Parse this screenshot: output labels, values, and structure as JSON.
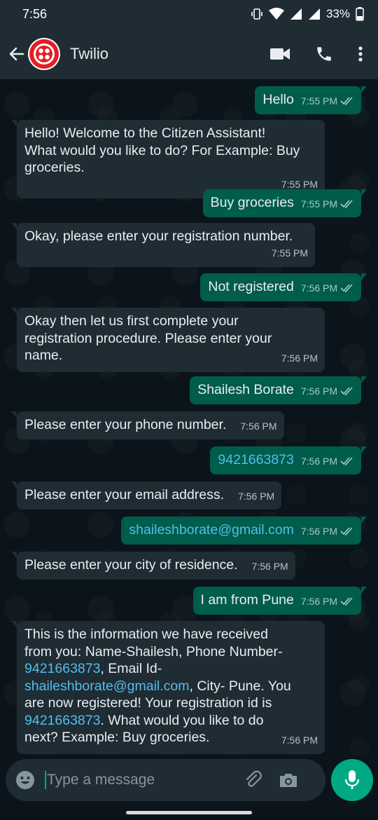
{
  "status": {
    "time": "7:56",
    "battery": "33%"
  },
  "header": {
    "title": "Twilio"
  },
  "messages": [
    {
      "dir": "out",
      "text": "Hello",
      "time": "7:55 PM"
    },
    {
      "dir": "in",
      "lines": [
        "Hello! Welcome to the Citizen Assistant!",
        "What would you like to do? For Example: Buy",
        "groceries."
      ],
      "time": "7:55 PM"
    },
    {
      "dir": "out",
      "text": "Buy groceries",
      "time": "7:55 PM"
    },
    {
      "dir": "in",
      "lines": [
        "Okay, please enter your registration number."
      ],
      "time": "7:55 PM"
    },
    {
      "dir": "out",
      "text": "Not registered",
      "time": "7:56 PM"
    },
    {
      "dir": "in",
      "lines": [
        "Okay then let us first complete your",
        "registration procedure. Please enter your",
        "name."
      ],
      "time": "7:56 PM"
    },
    {
      "dir": "out",
      "text": "Shailesh Borate",
      "time": "7:56 PM"
    },
    {
      "dir": "in",
      "text": "Please enter your phone number.",
      "time": "7:56 PM"
    },
    {
      "dir": "out",
      "text": "9421663873",
      "time": "7:56 PM"
    },
    {
      "dir": "in",
      "text": "Please enter your email address.",
      "time": "7:56 PM"
    },
    {
      "dir": "out",
      "text": "shaileshborate@gmail.com",
      "time": "7:56 PM"
    },
    {
      "dir": "in",
      "text": "Please enter your city of residence.",
      "time": "7:56 PM"
    },
    {
      "dir": "out",
      "text": "I am from Pune",
      "time": "7:56 PM"
    },
    {
      "dir": "in",
      "line1": "This is the information we have received",
      "line2": "from you: Name-Shailesh, Phone Number-",
      "phone": "9421663873",
      "line3b": ", Email Id-",
      "email": "shaileshborate@gmail.com",
      "line4b": ", City- Pune. You",
      "line5": "are now registered! Your registration id is",
      "line6b": ". What would you like to do",
      "line7": "next? Example: Buy groceries.",
      "time": "7:56 PM"
    }
  ],
  "composer": {
    "placeholder": "Type a message"
  },
  "icons": {
    "back": "arrow-left-icon",
    "avatar": "twilio-logo-icon",
    "video": "video-camera-icon",
    "call": "phone-icon",
    "menu": "more-vert-icon",
    "emoji": "emoji-icon",
    "attach": "paperclip-icon",
    "camera": "camera-icon",
    "mic": "microphone-icon"
  },
  "colors": {
    "header": "#1f2c34",
    "incoming": "#1f2c34",
    "outgoing": "#005c4b",
    "accent": "#00a884",
    "link": "#53bdeb",
    "ticks": "#a6cbc2"
  }
}
